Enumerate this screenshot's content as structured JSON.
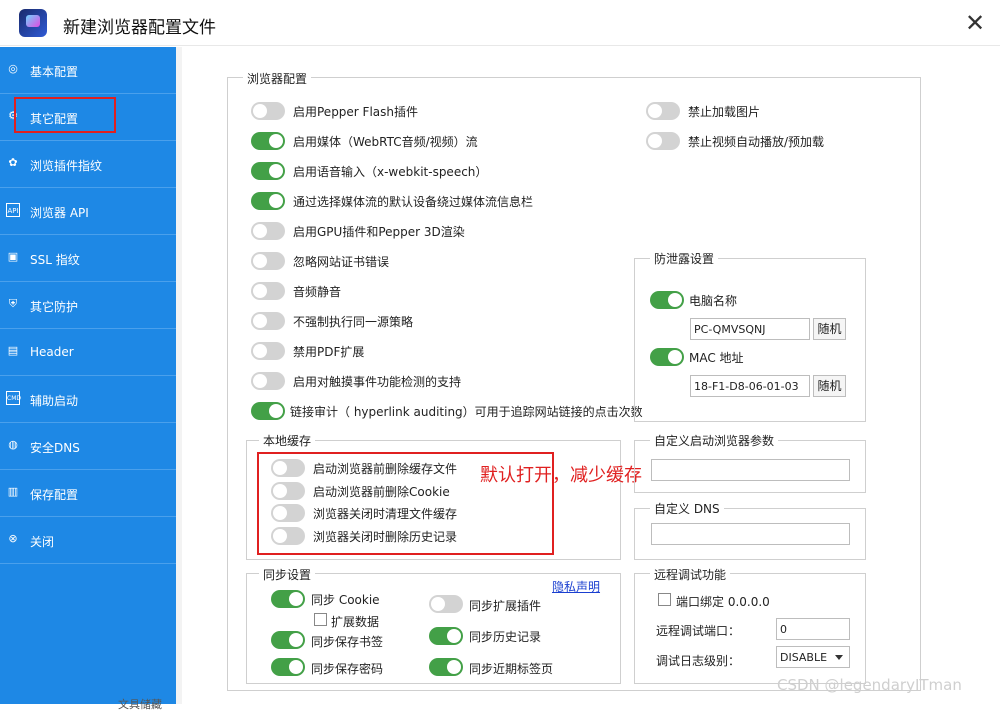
{
  "window": {
    "title": "新建浏览器配置文件",
    "close_glyph": "✕"
  },
  "sidebar": {
    "items": [
      {
        "label": "基本配置",
        "icon": "compass-icon"
      },
      {
        "label": "其它配置",
        "icon": "gear-icon"
      },
      {
        "label": "浏览插件指纹",
        "icon": "puzzle-icon"
      },
      {
        "label": "浏览器 API",
        "icon": "api-icon"
      },
      {
        "label": "SSL 指纹",
        "icon": "lock-icon"
      },
      {
        "label": "其它防护",
        "icon": "shield-icon"
      },
      {
        "label": "Header",
        "icon": "header-icon"
      },
      {
        "label": "辅助启动",
        "icon": "cmd-icon"
      },
      {
        "label": "安全DNS",
        "icon": "globe-icon"
      },
      {
        "label": "保存配置",
        "icon": "save-icon"
      },
      {
        "label": "关闭",
        "icon": "close-circle-icon"
      }
    ]
  },
  "browser": {
    "title": "浏览器配置",
    "options": [
      {
        "label": "启用Pepper Flash插件",
        "on": false
      },
      {
        "label": "启用媒体（WebRTC音频/视频）流",
        "on": true
      },
      {
        "label": "启用语音输入（x-webkit-speech）",
        "on": true
      },
      {
        "label": "通过选择媒体流的默认设备绕过媒体流信息栏",
        "on": true
      },
      {
        "label": "启用GPU插件和Pepper 3D渲染",
        "on": false
      },
      {
        "label": "忽略网站证书错误",
        "on": false
      },
      {
        "label": "音频静音",
        "on": false
      },
      {
        "label": "不强制执行同一源策略",
        "on": false
      },
      {
        "label": "禁用PDF扩展",
        "on": false
      },
      {
        "label": "启用对触摸事件功能检测的支持",
        "on": false
      },
      {
        "label": "链接审计（ hyperlink auditing）可用于追踪网站链接的点击次数",
        "on": true
      }
    ],
    "right_options": [
      {
        "label": "禁止加载图片",
        "on": false
      },
      {
        "label": "禁止视频自动播放/预加载",
        "on": false
      }
    ]
  },
  "leak": {
    "title": "防泄露设置",
    "pc_label": "电脑名称",
    "pc_on": true,
    "pc_value": "PC-QMVSQNJ",
    "mac_label": "MAC 地址",
    "mac_on": true,
    "mac_value": "18-F1-D8-06-01-03",
    "random_label": "随机"
  },
  "cache": {
    "title": "本地缓存",
    "options": [
      {
        "label": "启动浏览器前删除缓存文件",
        "on": false
      },
      {
        "label": "启动浏览器前删除Cookie",
        "on": false
      },
      {
        "label": "浏览器关闭时清理文件缓存",
        "on": false
      },
      {
        "label": "浏览器关闭时删除历史记录",
        "on": false
      }
    ]
  },
  "annotation": "默认打开，减少缓存",
  "startup": {
    "title": "自定义启动浏览器参数",
    "value": ""
  },
  "dns": {
    "title": "自定义 DNS",
    "value": ""
  },
  "sync": {
    "title": "同步设置",
    "privacy_link": "隐私声明",
    "cookie_label": "同步 Cookie",
    "cookie_on": true,
    "ext_data_label": "扩展数据",
    "ext_plugin_label": "同步扩展插件",
    "ext_plugin_on": false,
    "bookmarks_label": "同步保存书签",
    "bookmarks_on": true,
    "history_label": "同步历史记录",
    "history_on": true,
    "passwords_label": "同步保存密码",
    "passwords_on": true,
    "tabs_label": "同步近期标签页",
    "tabs_on": true
  },
  "remote": {
    "title": "远程调试功能",
    "bind_label": "端口绑定 0.0.0.0",
    "port_label": "远程调试端口：",
    "port_value": "0",
    "log_label": "调试日志级别：",
    "log_value": "DISABLE"
  },
  "watermark": "CSDN @legendaryITman",
  "footer_text": "文具储藏"
}
